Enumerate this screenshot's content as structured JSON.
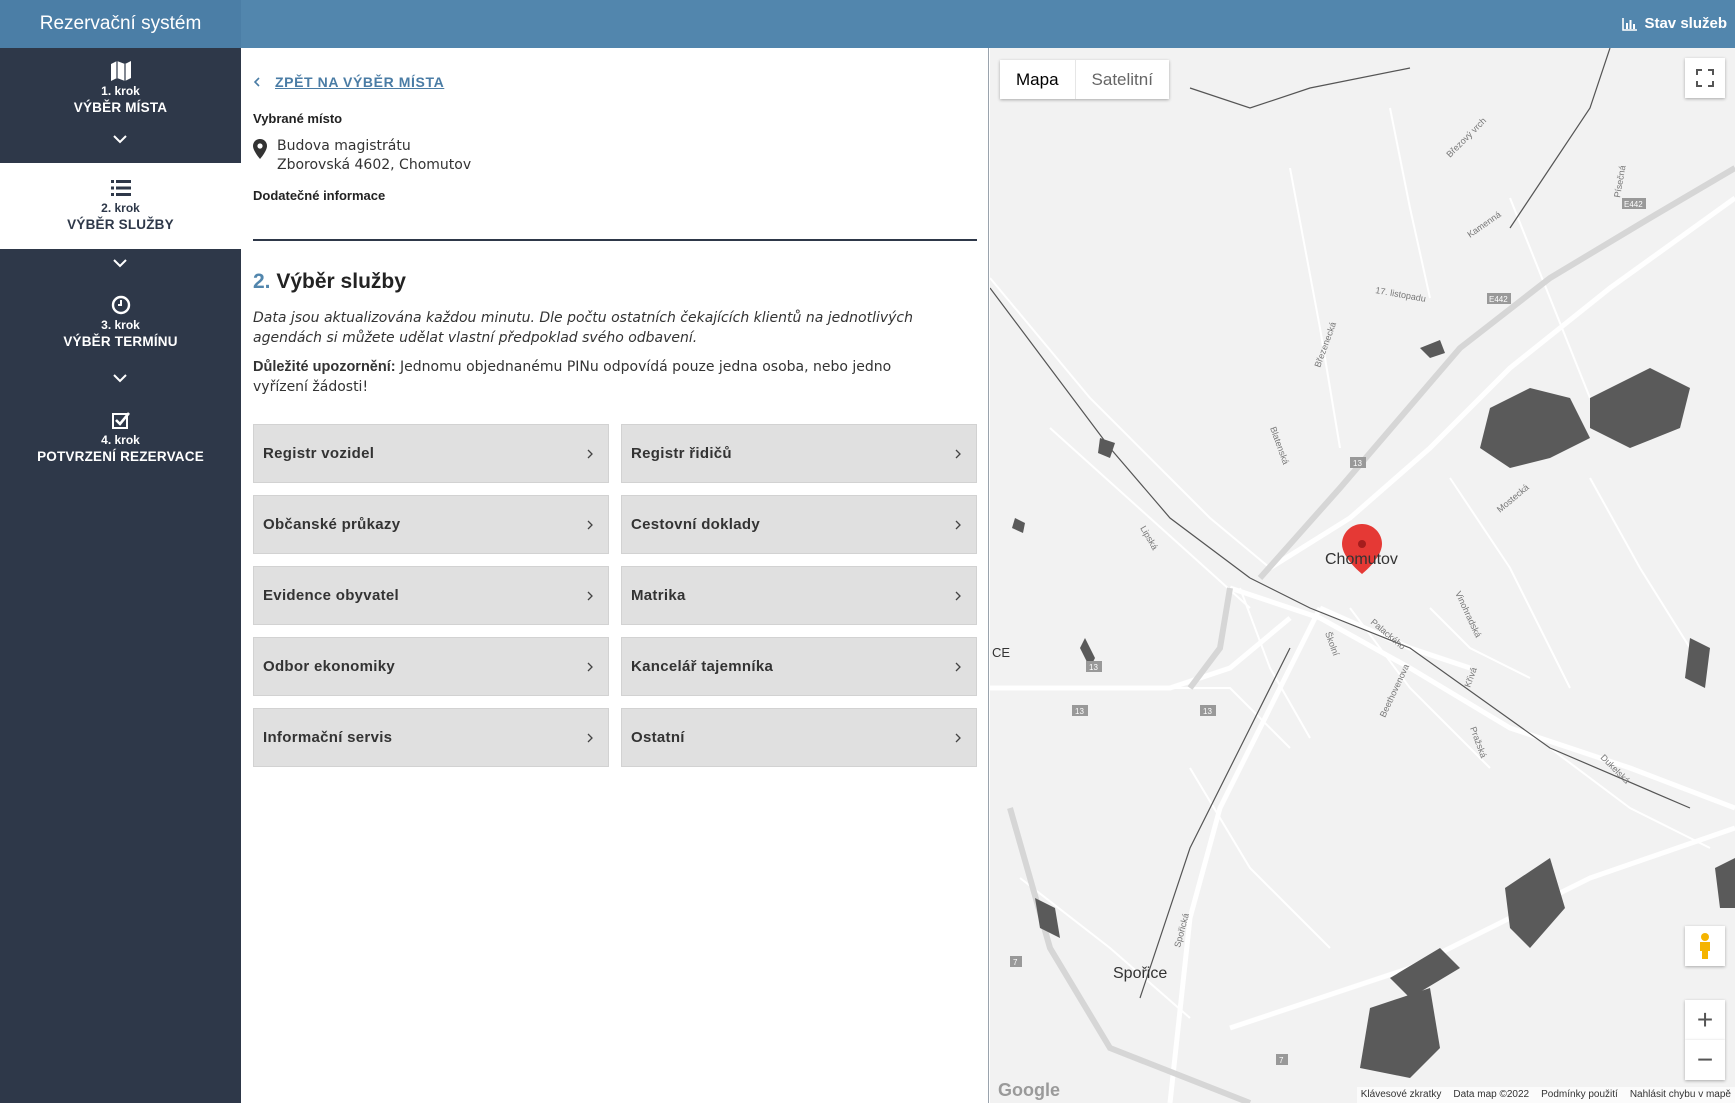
{
  "app": {
    "title": "Rezervační systém",
    "status_link": "Stav služeb"
  },
  "sidebar": {
    "steps": [
      {
        "num": "1. krok",
        "title": "VÝBĚR MÍSTA",
        "icon": "map-icon"
      },
      {
        "num": "2. krok",
        "title": "VÝBĚR SLUŽBY",
        "icon": "list-icon",
        "active": true
      },
      {
        "num": "3. krok",
        "title": "VÝBĚR TERMÍNU",
        "icon": "clock-icon"
      },
      {
        "num": "4. krok",
        "title": "POTVRZENÍ REZERVACE",
        "icon": "check-square-icon"
      }
    ]
  },
  "main": {
    "back_label": "ZPĚT NA VÝBĚR MÍSTA",
    "selected_label": "Vybrané místo",
    "place_name": "Budova magistrátu",
    "place_address": "Zborovská 4602, Chomutov",
    "additional_label": "Dodatečné informace",
    "section_number": "2.",
    "section_title": "Výběr služby",
    "description": "Data jsou aktualizována každou minutu. Dle počtu ostatních čekajících klientů na jednotlivých agendách si můžete udělat vlastní předpoklad svého odbavení.",
    "notice_bold": "Důležité upozornění:",
    "notice_text": " Jednomu objednanému PINu odpovídá pouze jedna osoba, nebo jedno vyřízení žádosti!",
    "services": [
      "Registr vozidel",
      "Registr řidičů",
      "Občanské průkazy",
      "Cestovní doklady",
      "Evidence obyvatel",
      "Matrika",
      "Odbor ekonomiky",
      "Kancelář tajemníka",
      "Informační servis",
      "Ostatní"
    ]
  },
  "map": {
    "type_map": "Mapa",
    "type_satellite": "Satelitní",
    "city_main": "Chomutov",
    "city_secondary": "Spořice",
    "edge_label": "CE",
    "roads": [
      "Lipská",
      "Blatenská",
      "Březenecká",
      "17. listopadu",
      "Kamenná",
      "Mostecká",
      "Palackého",
      "Školní",
      "Beethovenova",
      "Křivá",
      "Pražská",
      "Dukelská",
      "Vinohradská",
      "Spořická",
      "Březový vrch",
      "Písečná"
    ],
    "road_badges": [
      "E442",
      "E442",
      "13",
      "13",
      "13",
      "13",
      "7",
      "7"
    ],
    "attribution": [
      "Klávesové zkratky",
      "Data map ©2022",
      "Podmínky použití",
      "Nahlásit chybu v mapě"
    ],
    "google": "Google",
    "zoom_in": "+",
    "zoom_out": "−",
    "marker_color": "#e53935"
  }
}
